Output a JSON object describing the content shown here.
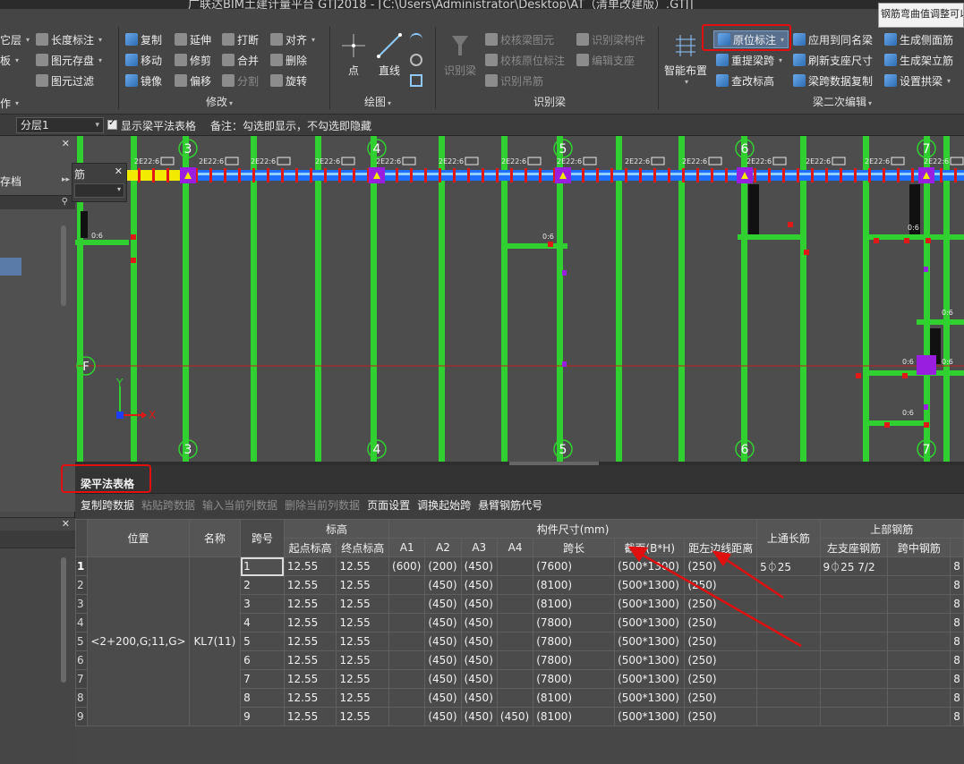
{
  "window": {
    "title": "广联达BIM土建计量平台 GTJ2018 - [C:\\Users\\Administrator\\Desktop\\AT（清单改建版）.GTJ]",
    "tooltip": "钢筋弯曲值调整可以"
  },
  "ribbon": {
    "left_col": [
      {
        "label": "它层",
        "icon": "layer-icon"
      },
      {
        "label": "板",
        "icon": "slab-icon"
      },
      {
        "label": "作",
        "icon": "operate-icon"
      }
    ],
    "measure_col": [
      {
        "label": "长度标注",
        "icon": "length-dimension-icon"
      },
      {
        "label": "图元存盘",
        "icon": "save-element-icon"
      },
      {
        "label": "图元过滤",
        "icon": "filter-icon"
      }
    ],
    "modify": {
      "group_label": "修改",
      "items": [
        {
          "label": "复制",
          "icon": "copy-icon",
          "dim": false
        },
        {
          "label": "延伸",
          "icon": "extend-icon",
          "dim": false
        },
        {
          "label": "打断",
          "icon": "break-icon",
          "dim": false
        },
        {
          "label": "对齐",
          "icon": "align-icon",
          "dim": false
        },
        {
          "label": "移动",
          "icon": "move-icon",
          "dim": false
        },
        {
          "label": "修剪",
          "icon": "trim-icon",
          "dim": false
        },
        {
          "label": "合并",
          "icon": "merge-icon",
          "dim": false
        },
        {
          "label": "删除",
          "icon": "delete-icon",
          "dim": false
        },
        {
          "label": "镜像",
          "icon": "mirror-icon",
          "dim": false
        },
        {
          "label": "偏移",
          "icon": "offset-icon",
          "dim": false
        },
        {
          "label": "分割",
          "icon": "split-icon",
          "dim": true
        },
        {
          "label": "旋转",
          "icon": "rotate-icon",
          "dim": false
        }
      ]
    },
    "draw": {
      "group_label": "绘图",
      "point_label": "点",
      "line_label": "直线"
    },
    "identify": {
      "group_label": "识别梁",
      "big_label": "识别梁",
      "items": [
        {
          "label": "校核梁图元"
        },
        {
          "label": "校核原位标注"
        },
        {
          "label": "识别吊筋"
        },
        {
          "label": "识别梁构件"
        },
        {
          "label": "编辑支座"
        }
      ]
    },
    "secondary": {
      "group_label": "梁二次编辑",
      "smart_layout": "智能布置",
      "items": [
        {
          "label": "原位标注",
          "icon": "inplace-annotation-icon",
          "active": true
        },
        {
          "label": "应用到同名梁",
          "icon": "apply-same-name-icon"
        },
        {
          "label": "生成侧面筋",
          "icon": "side-rebar-icon"
        },
        {
          "label": "重提梁跨",
          "icon": "re-extract-span-icon"
        },
        {
          "label": "刷新支座尺寸",
          "icon": "refresh-support-icon"
        },
        {
          "label": "生成架立筋",
          "icon": "erection-rebar-icon"
        },
        {
          "label": "查改标高",
          "icon": "elevation-icon"
        },
        {
          "label": "梁跨数据复制",
          "icon": "span-copy-icon"
        },
        {
          "label": "设置拱梁",
          "icon": "arch-beam-icon"
        }
      ]
    }
  },
  "optionbar": {
    "layer": "分层1",
    "checkbox_label": "显示梁平法表格",
    "checked": true,
    "note": "备注：勾选即显示，不勾选即隐藏"
  },
  "leftpanel": {
    "store_label": "存档",
    "tab_label": "筋"
  },
  "canvas": {
    "axes_top": [
      "3",
      "4",
      "5",
      "6",
      "7"
    ],
    "axes_bottom": [
      "3",
      "4",
      "5",
      "6",
      "7"
    ],
    "axis_row": "F",
    "beam_label": "2E22:6",
    "small_label": "0:6",
    "x_axis": "X",
    "y_axis": "Y"
  },
  "table": {
    "tab_label": "梁平法表格",
    "toolbar": [
      {
        "label": "复制跨数据",
        "dim": false
      },
      {
        "label": "粘贴跨数据",
        "dim": true
      },
      {
        "label": "输入当前列数据",
        "dim": true
      },
      {
        "label": "删除当前列数据",
        "dim": true
      },
      {
        "label": "页面设置",
        "dim": false
      },
      {
        "label": "调换起始跨",
        "dim": false
      },
      {
        "label": "悬臂钢筋代号",
        "dim": false
      }
    ],
    "headers": {
      "position": "位置",
      "name": "名称",
      "span": "跨号",
      "elevation": "标高",
      "start_elev": "起点标高",
      "end_elev": "终点标高",
      "dimensions": "构件尺寸(mm)",
      "a1": "A1",
      "a2": "A2",
      "a3": "A3",
      "a4": "A4",
      "span_len": "跨长",
      "section": "截面(B*H)",
      "left_dist": "距左边线距离",
      "top_long": "上通长筋",
      "top_rebar": "上部钢筋",
      "left_support": "左支座钢筋",
      "mid_span": "跨中钢筋"
    },
    "position_value": "<2+200,G;11,G>",
    "name_value": "KL7(11)",
    "rows": [
      {
        "rn": "1",
        "span": "1",
        "start": "12.55",
        "end": "12.55",
        "a1": "(600)",
        "a2": "(200)",
        "a3": "(450)",
        "a4": "",
        "len": "(7600)",
        "sec": "(500*1300)",
        "dist": "(250)",
        "toplong": "5⏀25",
        "left": "9⏀25 7/2",
        "mid": "",
        "r": "8"
      },
      {
        "rn": "2",
        "span": "2",
        "start": "12.55",
        "end": "12.55",
        "a1": "",
        "a2": "(450)",
        "a3": "(450)",
        "a4": "",
        "len": "(8100)",
        "sec": "(500*1300)",
        "dist": "(250)",
        "toplong": "",
        "left": "",
        "mid": "",
        "r": "8"
      },
      {
        "rn": "3",
        "span": "3",
        "start": "12.55",
        "end": "12.55",
        "a1": "",
        "a2": "(450)",
        "a3": "(450)",
        "a4": "",
        "len": "(8100)",
        "sec": "(500*1300)",
        "dist": "(250)",
        "toplong": "",
        "left": "",
        "mid": "",
        "r": "8"
      },
      {
        "rn": "4",
        "span": "4",
        "start": "12.55",
        "end": "12.55",
        "a1": "",
        "a2": "(450)",
        "a3": "(450)",
        "a4": "",
        "len": "(7800)",
        "sec": "(500*1300)",
        "dist": "(250)",
        "toplong": "",
        "left": "",
        "mid": "",
        "r": "8"
      },
      {
        "rn": "5",
        "span": "5",
        "start": "12.55",
        "end": "12.55",
        "a1": "",
        "a2": "(450)",
        "a3": "(450)",
        "a4": "",
        "len": "(7800)",
        "sec": "(500*1300)",
        "dist": "(250)",
        "toplong": "",
        "left": "",
        "mid": "",
        "r": "8"
      },
      {
        "rn": "6",
        "span": "6",
        "start": "12.55",
        "end": "12.55",
        "a1": "",
        "a2": "(450)",
        "a3": "(450)",
        "a4": "",
        "len": "(7800)",
        "sec": "(500*1300)",
        "dist": "(250)",
        "toplong": "",
        "left": "",
        "mid": "",
        "r": "8"
      },
      {
        "rn": "7",
        "span": "7",
        "start": "12.55",
        "end": "12.55",
        "a1": "",
        "a2": "(450)",
        "a3": "(450)",
        "a4": "",
        "len": "(7800)",
        "sec": "(500*1300)",
        "dist": "(250)",
        "toplong": "",
        "left": "",
        "mid": "",
        "r": "8"
      },
      {
        "rn": "8",
        "span": "8",
        "start": "12.55",
        "end": "12.55",
        "a1": "",
        "a2": "(450)",
        "a3": "(450)",
        "a4": "",
        "len": "(8100)",
        "sec": "(500*1300)",
        "dist": "(250)",
        "toplong": "",
        "left": "",
        "mid": "",
        "r": "8"
      },
      {
        "rn": "9",
        "span": "9",
        "start": "12.55",
        "end": "12.55",
        "a1": "",
        "a2": "(450)",
        "a3": "(450)",
        "a4": "(450)",
        "len": "(8100)",
        "sec": "(500*1300)",
        "dist": "(250)",
        "toplong": "",
        "left": "",
        "mid": "",
        "r": "8"
      }
    ]
  },
  "colors": {
    "beam_green": "#2fd02f",
    "beam_blue": "#1e6fff",
    "support_purple": "#9a1ee0",
    "marker_red": "#e01818",
    "highlight_red": "#e01010",
    "yellow": "#f2ea00"
  }
}
